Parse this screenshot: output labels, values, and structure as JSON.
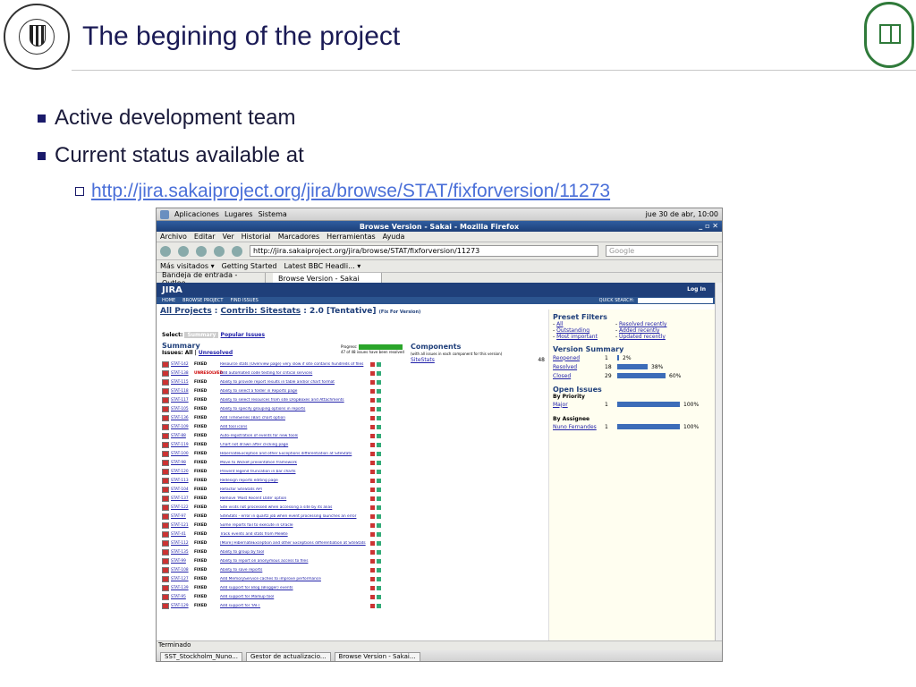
{
  "slide": {
    "title": "The begining of the project",
    "bullets": [
      "Active development team",
      "Current status available at"
    ],
    "link": "http://jira.sakaiproject.org/jira/browse/STAT/fixforversion/11273"
  },
  "browser": {
    "panel_menu": [
      "Aplicaciones",
      "Lugares",
      "Sistema"
    ],
    "clock": "jue 30 de abr, 10:00",
    "window_title": "Browse Version - Sakai - Mozilla Firefox",
    "menu": [
      "Archivo",
      "Editar",
      "Ver",
      "Historial",
      "Marcadores",
      "Herramientas",
      "Ayuda"
    ],
    "url": "http://jira.sakaiproject.org/jira/browse/STAT/fixforversion/11273",
    "search_placeholder": "Google",
    "bookmarks": [
      "Más visitados ▾",
      "Getting Started",
      "Latest BBC Headli... ▾"
    ],
    "tabs": [
      "Bandeja de entrada - Outloo...",
      "Browse Version - Sakai"
    ],
    "status": "Terminado",
    "taskbar": [
      "SST_Stockholm_Nuno...",
      "Gestor de actualizacio...",
      "Browse Version - Sakai..."
    ]
  },
  "jira": {
    "logo": "JIRA",
    "login": "Log In",
    "nav": [
      "HOME",
      "BROWSE PROJECT",
      "FIND ISSUES"
    ],
    "quick_search": "QUICK SEARCH:",
    "crumb_all": "All Projects",
    "crumb_contrib": "Contrib: Sitestats",
    "crumb_version": ": 2.0 [Tentative]",
    "crumb_small": "(Fix For Version)",
    "select_label": "Select:",
    "select_summary": "Summary",
    "select_popular": "Popular Issues",
    "summary_title": "Summary",
    "issues_label": "Issues:",
    "issues_all": "All",
    "issues_unresolved": "Unresolved",
    "progress_label": "Progress:",
    "progress_text": "47 of 48 issues have been resolved",
    "progress_fraction": 0.98,
    "components_title": "Components",
    "components_note": "(with all issues in each component for this version)",
    "component_name": "SiteStats",
    "component_count": "48",
    "issues": [
      {
        "key": "STAT-142",
        "status": "FIXED",
        "summary": "Resource stats (Overview page) very slow if site contains hundreds of files"
      },
      {
        "key": "STAT-138",
        "status": "UNRESOLVED",
        "summary": "Add automated code testing for critical services"
      },
      {
        "key": "STAT-115",
        "status": "FIXED",
        "summary": "Ability to provide report results in table and/or chart format"
      },
      {
        "key": "STAT-118",
        "status": "FIXED",
        "summary": "Ability to select a folder in Reports page"
      },
      {
        "key": "STAT-117",
        "status": "FIXED",
        "summary": "Ability to select resources from site DropBoxes and Attachments"
      },
      {
        "key": "STAT-105",
        "status": "FIXED",
        "summary": "Ability to specify grouping options in reports"
      },
      {
        "key": "STAT-136",
        "status": "FIXED",
        "summary": "Add TimeSeries (Bar) chart option"
      },
      {
        "key": "STAT-109",
        "status": "FIXED",
        "summary": "Add tool icons"
      },
      {
        "key": "STAT-88",
        "status": "FIXED",
        "summary": "Auto-registration of events for new tools"
      },
      {
        "key": "STAT-119",
        "status": "FIXED",
        "summary": "Chart not drawn after clicking page"
      },
      {
        "key": "STAT-100",
        "status": "FIXED",
        "summary": "HibernateException and other Exceptions differentiation at SiteStats"
      },
      {
        "key": "STAT-98",
        "status": "FIXED",
        "summary": "Move to Wicket presentation framework"
      },
      {
        "key": "STAT-120",
        "status": "FIXED",
        "summary": "Prevent legend truncation in bar charts"
      },
      {
        "key": "STAT-113",
        "status": "FIXED",
        "summary": "Redesign reports editing page"
      },
      {
        "key": "STAT-104",
        "status": "FIXED",
        "summary": "Refactor SiteStats API"
      },
      {
        "key": "STAT-137",
        "status": "FIXED",
        "summary": "Remove 'Most Recent Date' option"
      },
      {
        "key": "STAT-122",
        "status": "FIXED",
        "summary": "Site visits not processed when accessing a site by its alias"
      },
      {
        "key": "STAT-97",
        "status": "FIXED",
        "summary": "SiteStats - error in quartz job when event processing launches an error"
      },
      {
        "key": "STAT-121",
        "status": "FIXED",
        "summary": "Some reports fail to execute in Oracle"
      },
      {
        "key": "STAT-41",
        "status": "FIXED",
        "summary": "Track events and stats from Melete"
      },
      {
        "key": "STAT-112",
        "status": "FIXED",
        "summary": "[More] HibernateException and other Exceptions differentiation at SiteStats"
      },
      {
        "key": "STAT-135",
        "status": "FIXED",
        "summary": "Ability to group by tool"
      },
      {
        "key": "STAT-99",
        "status": "FIXED",
        "summary": "Ability to report on anonymous access to files"
      },
      {
        "key": "STAT-108",
        "status": "FIXED",
        "summary": "Ability to save reports"
      },
      {
        "key": "STAT-127",
        "status": "FIXED",
        "summary": "Add MemoryService caches to improve performance"
      },
      {
        "key": "STAT-139",
        "status": "FIXED",
        "summary": "Add support for Blog (Blogger) events"
      },
      {
        "key": "STAT-95",
        "status": "FIXED",
        "summary": "Add support for Markup tool"
      },
      {
        "key": "STAT-129",
        "status": "FIXED",
        "summary": "Add support for YAFT"
      }
    ],
    "preset_title": "Preset Filters",
    "preset_left": [
      "All",
      "Outstanding",
      "Most important"
    ],
    "preset_right": [
      "Resolved recently",
      "Added recently",
      "Updated recently"
    ],
    "version_title": "Version Summary",
    "version_rows": [
      {
        "label": "Reopened",
        "count": "1",
        "pct": "2%",
        "fraction": 0.02
      },
      {
        "label": "Resolved",
        "count": "18",
        "pct": "38%",
        "fraction": 0.38
      },
      {
        "label": "Closed",
        "count": "29",
        "pct": "60%",
        "fraction": 0.6
      }
    ],
    "open_title": "Open Issues",
    "by_priority": "By Priority",
    "priority_row": {
      "label": "Major",
      "count": "1",
      "pct": "100%",
      "fraction": 1.0
    },
    "by_assignee": "By Assignee",
    "assignee_row": {
      "label": "Nuno Fernandes",
      "count": "1",
      "pct": "100%",
      "fraction": 1.0
    }
  }
}
